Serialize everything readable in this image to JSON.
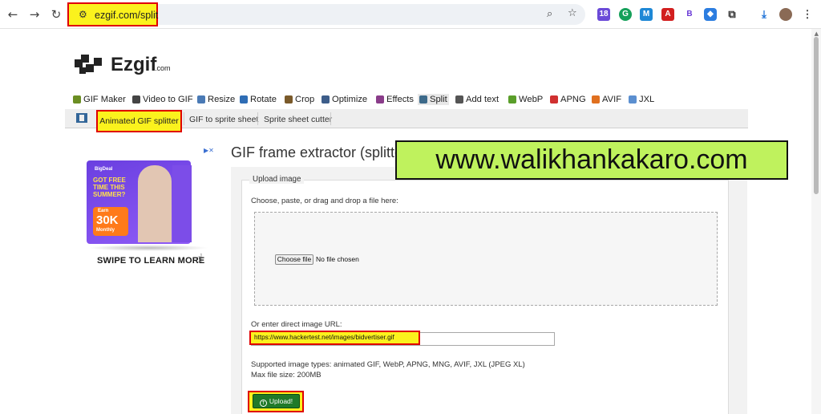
{
  "browser": {
    "url": "ezgif.com/split",
    "extension_badge": "18"
  },
  "site": {
    "logo_text": "Ezgif",
    "logo_suffix": ".com"
  },
  "tools": [
    {
      "label": "GIF Maker",
      "icon": "gif-maker-icon",
      "color": "#6b8e23"
    },
    {
      "label": "Video to GIF",
      "icon": "video-icon",
      "color": "#444444"
    },
    {
      "label": "Resize",
      "icon": "resize-icon",
      "color": "#4a7ab5"
    },
    {
      "label": "Rotate",
      "icon": "rotate-icon",
      "color": "#2f6db5"
    },
    {
      "label": "Crop",
      "icon": "crop-icon",
      "color": "#7a5a2a"
    },
    {
      "label": "Optimize",
      "icon": "optimize-icon",
      "color": "#3d5d8a"
    },
    {
      "label": "Effects",
      "icon": "effects-icon",
      "color": "#8a3d8a"
    },
    {
      "label": "Split",
      "icon": "split-icon",
      "color": "#3d6a8a"
    },
    {
      "label": "Add text",
      "icon": "add-text-icon",
      "color": "#555555"
    },
    {
      "label": "WebP",
      "icon": "webp-icon",
      "color": "#5a9e2a"
    },
    {
      "label": "APNG",
      "icon": "apng-icon",
      "color": "#d03030"
    },
    {
      "label": "AVIF",
      "icon": "avif-icon",
      "color": "#e07020"
    },
    {
      "label": "JXL",
      "icon": "jxl-icon",
      "color": "#5b8fd0"
    }
  ],
  "subnav": {
    "active": "Animated GIF splitter",
    "items": [
      "GIF to sprite sheet",
      "Sprite sheet cutter"
    ]
  },
  "ad": {
    "brand": "BigDeal",
    "headline": "GOT FREE TIME THIS SUMMER?",
    "earn": "Earn",
    "amount": "30K",
    "period": "Monthly",
    "cta": "SWIPE TO LEARN MORE"
  },
  "main": {
    "title": "GIF frame extractor (splitter)",
    "legend": "Upload image",
    "instruction": "Choose, paste, or drag and drop a file here:",
    "file_button": "Choose file",
    "no_file": "No file chosen",
    "url_label": "Or enter direct image URL:",
    "url_value": "https://www.hackertest.net/images/bidvertiser.gif",
    "supported": "Supported image types: animated GIF, WebP, APNG, MNG, AVIF, JXL (JPEG XL)",
    "max_size": "Max file size: 200MB",
    "upload_label": "Upload!"
  },
  "watermark": "www.walikhankakaro.com",
  "colors": {
    "highlight": "#fbf21d",
    "highlight_border": "#e00000",
    "upload_green": "#1f7a29",
    "watermark_bg": "#bff25d"
  }
}
